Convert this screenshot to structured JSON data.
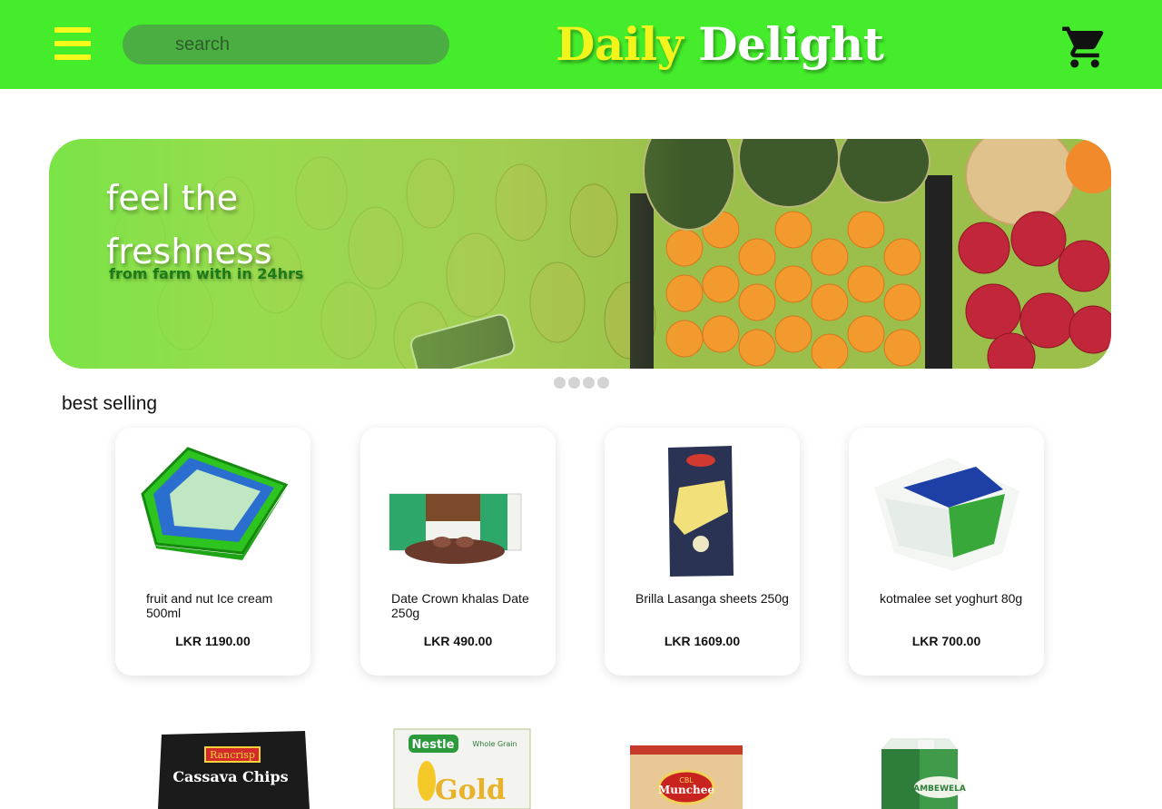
{
  "header": {
    "search_placeholder": "search",
    "brand_part1": "Daily",
    "brand_part2": "Delight",
    "menu_icon": "hamburger-menu-icon",
    "cart_icon": "shopping-cart-icon"
  },
  "banner": {
    "title": "feel the freshness",
    "subtitle": "from farm with in 24hrs",
    "slides": 4
  },
  "best_selling": {
    "title": "best selling",
    "products": [
      {
        "name": "fruit and nut Ice cream 500ml",
        "price": "LKR 1190.00"
      },
      {
        "name": "Date Crown khalas Date 250g",
        "price": "LKR 490.00"
      },
      {
        "name": "Brilla Lasanga sheets 250g",
        "price": "LKR 1609.00"
      },
      {
        "name": "kotmalee set yoghurt 80g",
        "price": "LKR 700.00"
      }
    ]
  },
  "more_products": {
    "labels": [
      "Rancrisp",
      "Cassava Chips",
      "Nestle",
      "Whole Grain",
      "Gold",
      "CBL",
      "Munchee",
      "AMBEWELA"
    ]
  },
  "colors": {
    "header_bg": "#44ec2b",
    "menu_yellow": "#f5f91c",
    "search_bg": "#4aae42",
    "brand_yellow": "#f2f41c",
    "banner_sub_green": "#1d7a18"
  }
}
